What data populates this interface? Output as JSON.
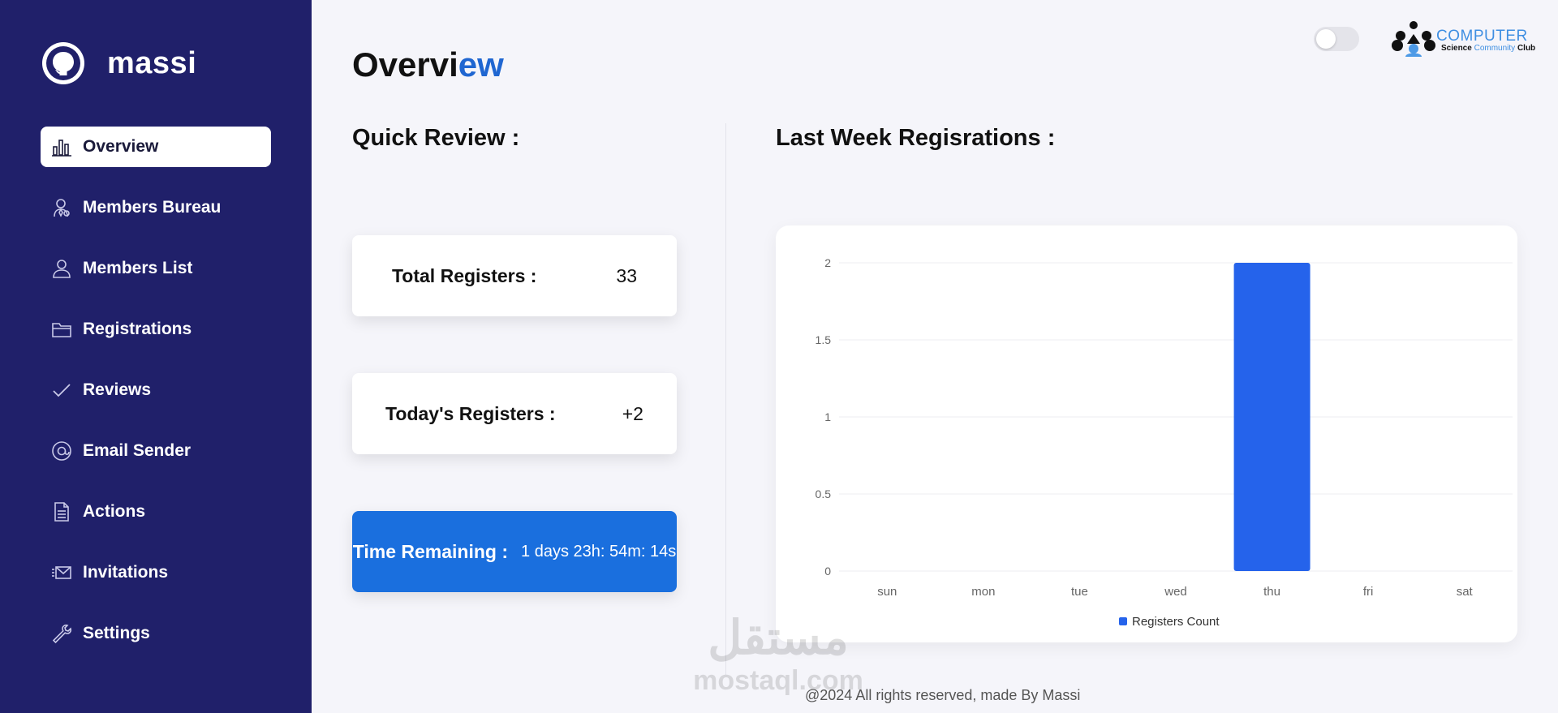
{
  "brand": {
    "name": "massi",
    "logo_icon": "github-icon"
  },
  "sidebar": {
    "items": [
      {
        "label": "Overview",
        "icon": "bar-chart-icon",
        "active": true
      },
      {
        "label": "Members Bureau",
        "icon": "user-tie-icon",
        "active": false
      },
      {
        "label": "Members List",
        "icon": "user-icon",
        "active": false
      },
      {
        "label": "Registrations",
        "icon": "folder-icon",
        "active": false
      },
      {
        "label": "Reviews",
        "icon": "check-icon",
        "active": false
      },
      {
        "label": "Email Sender",
        "icon": "at-sign-icon",
        "active": false
      },
      {
        "label": "Actions",
        "icon": "document-icon",
        "active": false
      },
      {
        "label": "Invitations",
        "icon": "envelope-icon",
        "active": false
      },
      {
        "label": "Settings",
        "icon": "wrench-icon",
        "active": false
      }
    ]
  },
  "header": {
    "title_main": "Overvi",
    "title_accent": "ew",
    "club_logo": {
      "line1": "COMPUTER",
      "line2_a": "Science",
      "line2_b": "Community",
      "line2_c": "Club"
    }
  },
  "quick_review": {
    "title": "Quick Review :",
    "total_label": "Total Registers :",
    "total_value": "33",
    "today_label": "Today's Registers :",
    "today_value": "+2",
    "time_label": "Time Remaining :",
    "time_value": "1 days 23h: 54m: 14s"
  },
  "last_week": {
    "title": "Last Week Regisrations :"
  },
  "chart_data": {
    "type": "bar",
    "categories": [
      "sun",
      "mon",
      "tue",
      "wed",
      "thu",
      "fri",
      "sat"
    ],
    "series": [
      {
        "name": "Registers Count",
        "values": [
          0,
          0,
          0,
          0,
          2,
          0,
          0
        ],
        "color": "#2563eb"
      }
    ],
    "yticks": [
      "0",
      "0.5",
      "1",
      "1.5",
      "2"
    ],
    "ylim": [
      0,
      2
    ],
    "grid": true,
    "legend": "bottom"
  },
  "watermark": {
    "arabic": "مستقل",
    "latin": "mostaql.com"
  },
  "footer": {
    "text": "@2024 All rights reserved, made By Massi"
  },
  "colors": {
    "sidebar": "#20206a",
    "accent": "#1f66d1",
    "bar": "#2563eb",
    "timer_card": "#1a6fde"
  }
}
